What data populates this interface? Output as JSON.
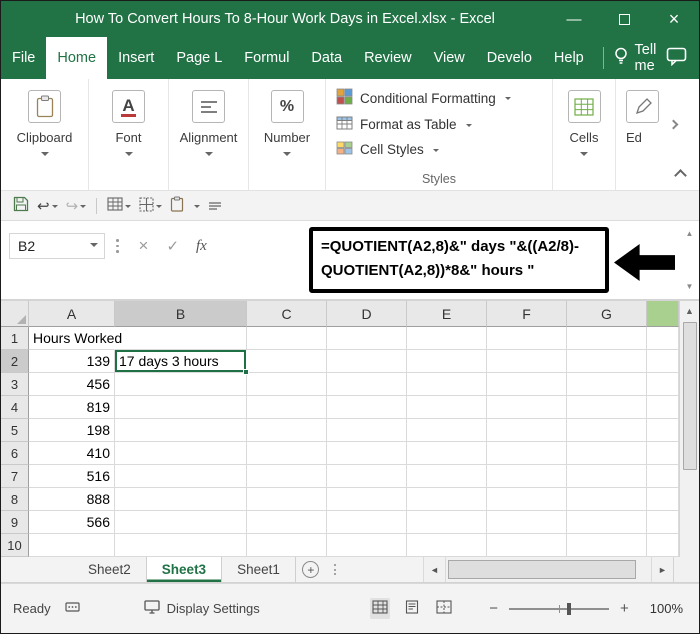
{
  "titlebar": {
    "title": "How To Convert Hours To 8-Hour Work Days in Excel.xlsx - Excel"
  },
  "ribbon_tabs": {
    "items": [
      {
        "label": "File"
      },
      {
        "label": "Home"
      },
      {
        "label": "Insert"
      },
      {
        "label": "Page L"
      },
      {
        "label": "Formul"
      },
      {
        "label": "Data"
      },
      {
        "label": "Review"
      },
      {
        "label": "View"
      },
      {
        "label": "Develo"
      },
      {
        "label": "Help"
      }
    ],
    "active": "Home",
    "tell_me": "Tell me"
  },
  "ribbon": {
    "groups": [
      {
        "label": "Clipboard"
      },
      {
        "label": "Font"
      },
      {
        "label": "Alignment"
      },
      {
        "label": "Number"
      }
    ],
    "styles": {
      "items": [
        "Conditional Formatting",
        "Format as Table",
        "Cell Styles"
      ],
      "label": "Styles"
    },
    "cells_label": "Cells",
    "editing_label": "Ed"
  },
  "formula_bar": {
    "name_box": "B2",
    "formula_line1": "=QUOTIENT(A2,8)&\" days \"&((A2/8)-",
    "formula_line2": "QUOTIENT(A2,8))*8&\" hours \""
  },
  "grid": {
    "columns": [
      "A",
      "B",
      "C",
      "D",
      "E",
      "F",
      "G"
    ],
    "selected_cell": "B2",
    "rows": [
      {
        "num": "1",
        "cells": [
          "Hours Worked",
          "",
          "",
          "",
          "",
          "",
          ""
        ]
      },
      {
        "num": "2",
        "cells": [
          "139",
          "17 days 3 hours",
          "",
          "",
          "",
          "",
          ""
        ]
      },
      {
        "num": "3",
        "cells": [
          "456",
          "",
          "",
          "",
          "",
          "",
          ""
        ]
      },
      {
        "num": "4",
        "cells": [
          "819",
          "",
          "",
          "",
          "",
          "",
          ""
        ]
      },
      {
        "num": "5",
        "cells": [
          "198",
          "",
          "",
          "",
          "",
          "",
          ""
        ]
      },
      {
        "num": "6",
        "cells": [
          "410",
          "",
          "",
          "",
          "",
          "",
          ""
        ]
      },
      {
        "num": "7",
        "cells": [
          "516",
          "",
          "",
          "",
          "",
          "",
          ""
        ]
      },
      {
        "num": "8",
        "cells": [
          "888",
          "",
          "",
          "",
          "",
          "",
          ""
        ]
      },
      {
        "num": "9",
        "cells": [
          "566",
          "",
          "",
          "",
          "",
          "",
          ""
        ]
      },
      {
        "num": "10",
        "cells": [
          "",
          "",
          "",
          "",
          "",
          "",
          ""
        ]
      }
    ]
  },
  "sheet_tabs": {
    "items": [
      {
        "label": "Sheet2"
      },
      {
        "label": "Sheet3",
        "active": true
      },
      {
        "label": "Sheet1"
      }
    ]
  },
  "status_bar": {
    "ready": "Ready",
    "display_settings": "Display Settings",
    "zoom_level": "100%"
  },
  "colors": {
    "excel_green": "#217346",
    "selection_green": "#1e7145",
    "header_highlight": "#cbcbcb",
    "stub_green": "#a9d08e",
    "annotation_black": "#000000"
  },
  "icons": {
    "minimize": "—",
    "close": "×",
    "font": "A",
    "percent": "%",
    "undo": "↩",
    "redo": "↪",
    "cancel": "×",
    "enter": "✓",
    "fx": "fx",
    "up": "▲",
    "down": "▼",
    "left": "◄",
    "right": "►",
    "add_sheet": "+",
    "zoom_out": "−",
    "zoom_in": "+"
  }
}
